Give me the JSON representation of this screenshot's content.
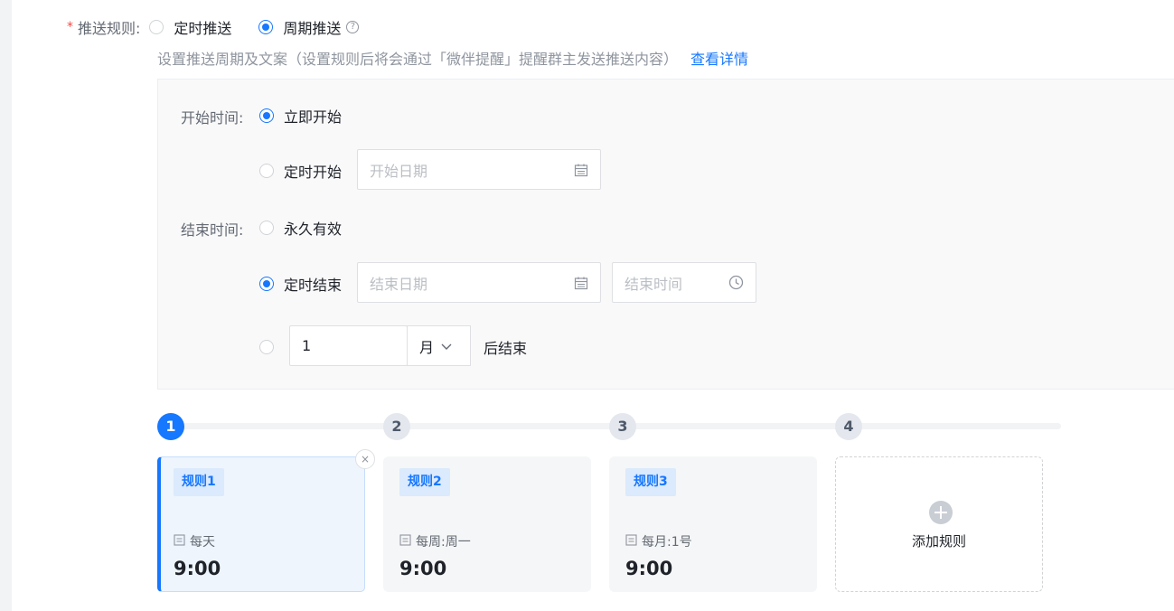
{
  "push_rule": {
    "label": "推送规则:",
    "required_mark": "*",
    "options": [
      {
        "label": "定时推送",
        "selected": false
      },
      {
        "label": "周期推送",
        "selected": true
      }
    ],
    "help_icon": "question-circle-icon",
    "help_glyph": "?"
  },
  "description": {
    "text": "设置推送周期及文案（设置规则后将会通过「微伴提醒」提醒群主发送推送内容）",
    "link": "查看详情"
  },
  "start": {
    "label": "开始时间:",
    "immediate_label": "立即开始",
    "immediate_selected": true,
    "scheduled_label": "定时开始",
    "scheduled_selected": false,
    "date_placeholder": "开始日期"
  },
  "end": {
    "label": "结束时间:",
    "forever_label": "永久有效",
    "forever_selected": false,
    "scheduled_label": "定时结束",
    "scheduled_selected": true,
    "date_placeholder": "结束日期",
    "time_placeholder": "结束时间",
    "duration_selected": false,
    "duration_value": "1",
    "duration_unit": "月",
    "duration_suffix": "后结束"
  },
  "steps": [
    "1",
    "2",
    "3",
    "4"
  ],
  "active_step": 1,
  "rules": [
    {
      "tag": "规则1",
      "frequency": "每天",
      "time": "9:00",
      "active": true
    },
    {
      "tag": "规则2",
      "frequency": "每周:周一",
      "time": "9:00",
      "active": false
    },
    {
      "tag": "规则3",
      "frequency": "每月:1号",
      "time": "9:00",
      "active": false
    }
  ],
  "close_glyph": "×",
  "add_rule_label": "添加规则",
  "colors": {
    "primary": "#1677ff",
    "required": "#f54a45",
    "panel_bg": "#f9f9fa"
  }
}
